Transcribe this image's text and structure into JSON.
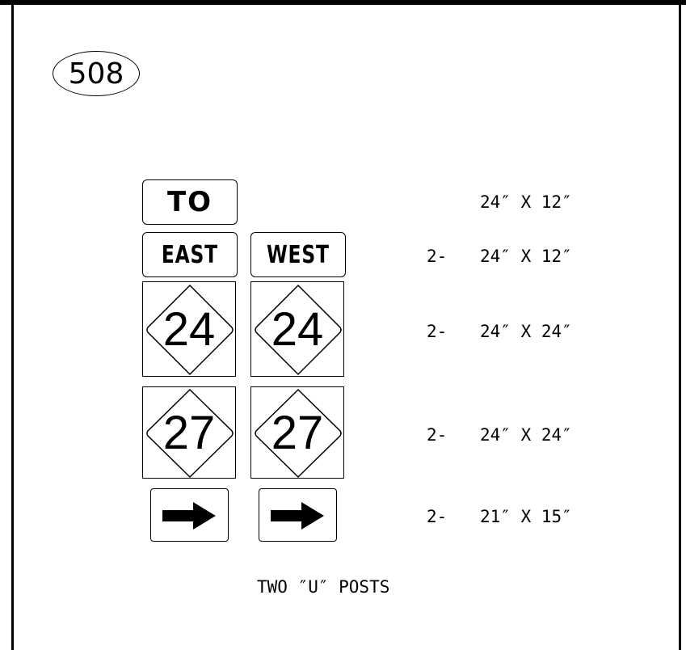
{
  "sheet_number": "508",
  "signs": {
    "to": "TO",
    "east": "EAST",
    "west": "WEST",
    "route_a": "24",
    "route_b": "27"
  },
  "arrow_icon": "right-arrow-icon",
  "specs": [
    {
      "qty": "",
      "size": "24″ X 12″"
    },
    {
      "qty": "2-",
      "size": "24″ X 12″"
    },
    {
      "qty": "2-",
      "size": "24″ X 24″"
    },
    {
      "qty": "2-",
      "size": "24″ X 24″"
    },
    {
      "qty": "2-",
      "size": "21″ X 15″"
    }
  ],
  "posts_note": "TWO ″U″ POSTS"
}
